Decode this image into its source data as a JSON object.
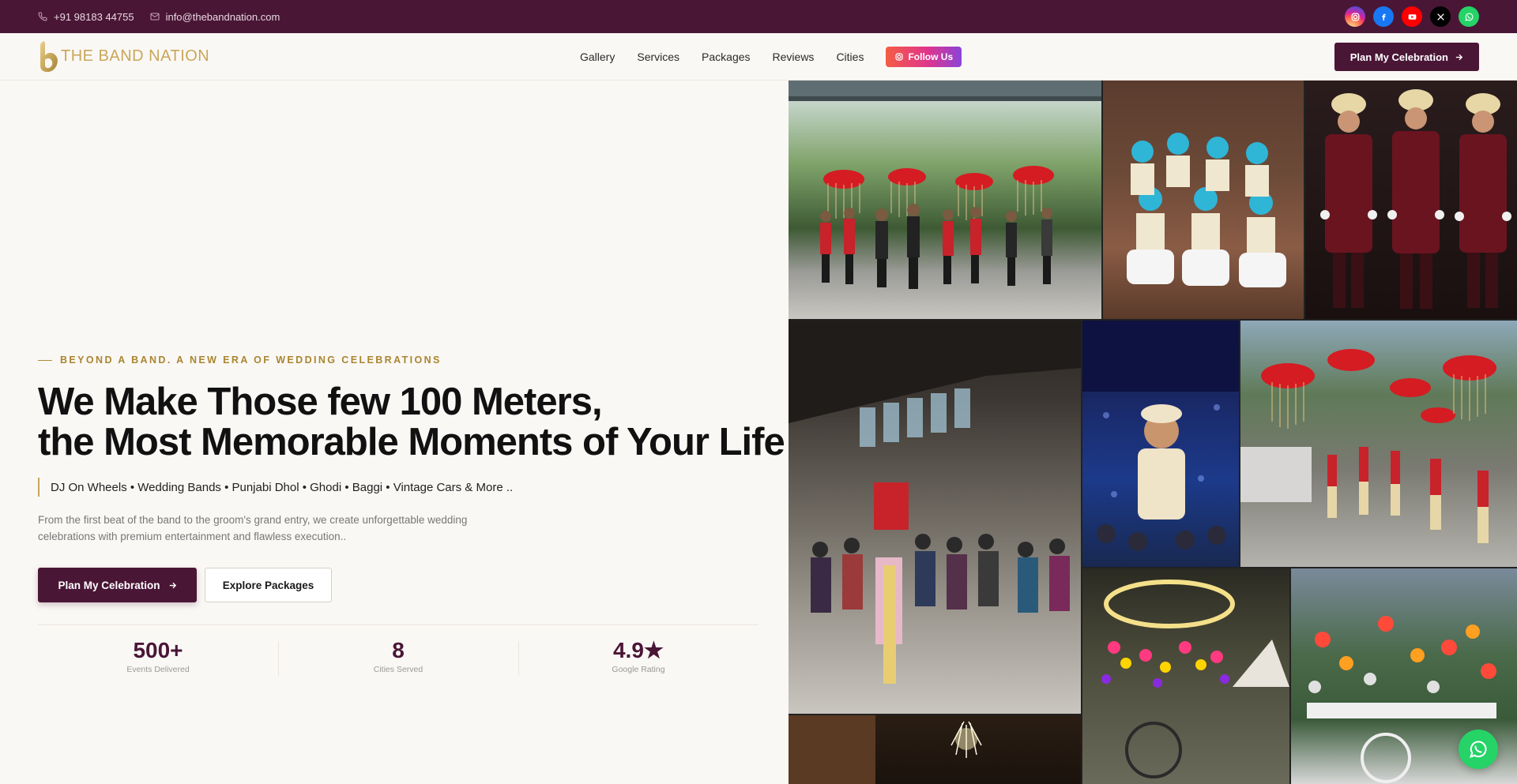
{
  "topbar": {
    "phone": "+91 98183 44755",
    "email": "info@thebandnation.com",
    "socials": [
      {
        "icon": "instagram-icon",
        "color": "#d62976"
      },
      {
        "icon": "facebook-icon",
        "color": "#1877f2"
      },
      {
        "icon": "youtube-icon",
        "color": "#ff0000"
      },
      {
        "icon": "x-icon",
        "color": "#000000"
      },
      {
        "icon": "whatsapp-icon",
        "color": "#25d366"
      }
    ]
  },
  "nav": {
    "logo_text": "THE BAND NATION",
    "links": [
      "Gallery",
      "Services",
      "Packages",
      "Reviews",
      "Cities"
    ],
    "follow_label": "Follow Us",
    "cta_label": "Plan My Celebration"
  },
  "hero": {
    "eyebrow": "BEYOND A BAND. A NEW ERA OF WEDDING CELEBRATIONS",
    "headline_line1": "We Make Those few 100 Meters,",
    "headline_line2": "the Most Memorable Moments of Your Life",
    "services": "DJ On Wheels • Wedding Bands • Punjabi Dhol • Ghodi • Baggi • Vintage Cars & More ..",
    "description": "From the first beat of the band to the groom's grand entry, we create unforgettable wedding celebrations with premium entertainment and flawless execution..",
    "primary_cta": "Plan My Celebration",
    "secondary_cta": "Explore Packages"
  },
  "stats": [
    {
      "value": "500+",
      "label": "Events Delivered"
    },
    {
      "value": "8",
      "label": "Cities Served"
    },
    {
      "value": "4.9★",
      "label": "Google Rating"
    }
  ],
  "colors": {
    "brand": "#4a1636",
    "gold": "#c9a65a",
    "background": "#faf8f5"
  }
}
